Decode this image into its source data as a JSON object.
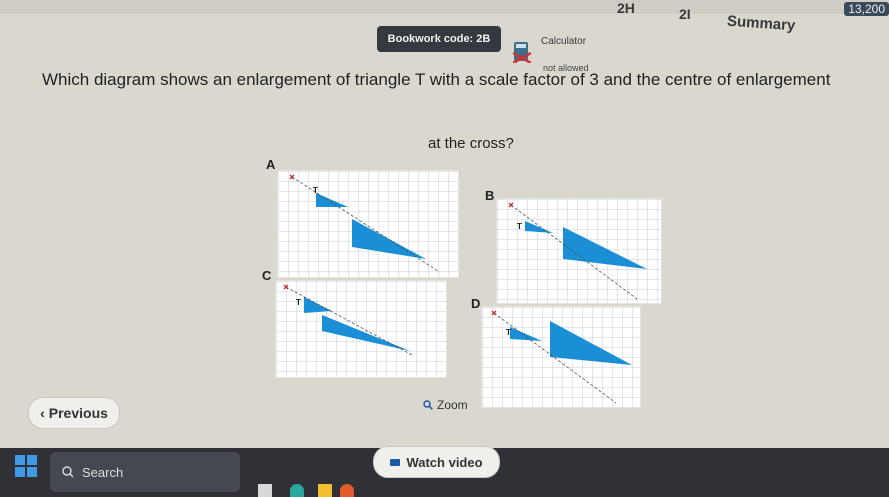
{
  "header": {
    "tabs": [
      {
        "label": "2H"
      },
      {
        "label": "2I"
      },
      {
        "label": "Summary"
      }
    ],
    "score": "13,200"
  },
  "bookwork": {
    "code_label": "Bookwork code: 2B"
  },
  "calculator": {
    "label": "Calculator",
    "status": "not allowed",
    "icon": "calculator-crossed-icon"
  },
  "question": {
    "line1": "Which diagram shows an enlargement of triangle T with a scale factor of 3 and the centre of enlargement",
    "line2": "at the cross?"
  },
  "diagrams": [
    {
      "label": "A",
      "triangle": "T"
    },
    {
      "label": "B",
      "triangle": "T"
    },
    {
      "label": "C",
      "triangle": "T"
    },
    {
      "label": "D",
      "triangle": "T"
    }
  ],
  "controls": {
    "previous_label": "Previous",
    "zoom_label": "Zoom",
    "watch_video_label": "Watch video"
  },
  "taskbar": {
    "search_label": "Search"
  },
  "colors": {
    "triangle_fill": "#1a8fd6",
    "grid_line": "#b9c1cc",
    "cross": "#d03030"
  }
}
